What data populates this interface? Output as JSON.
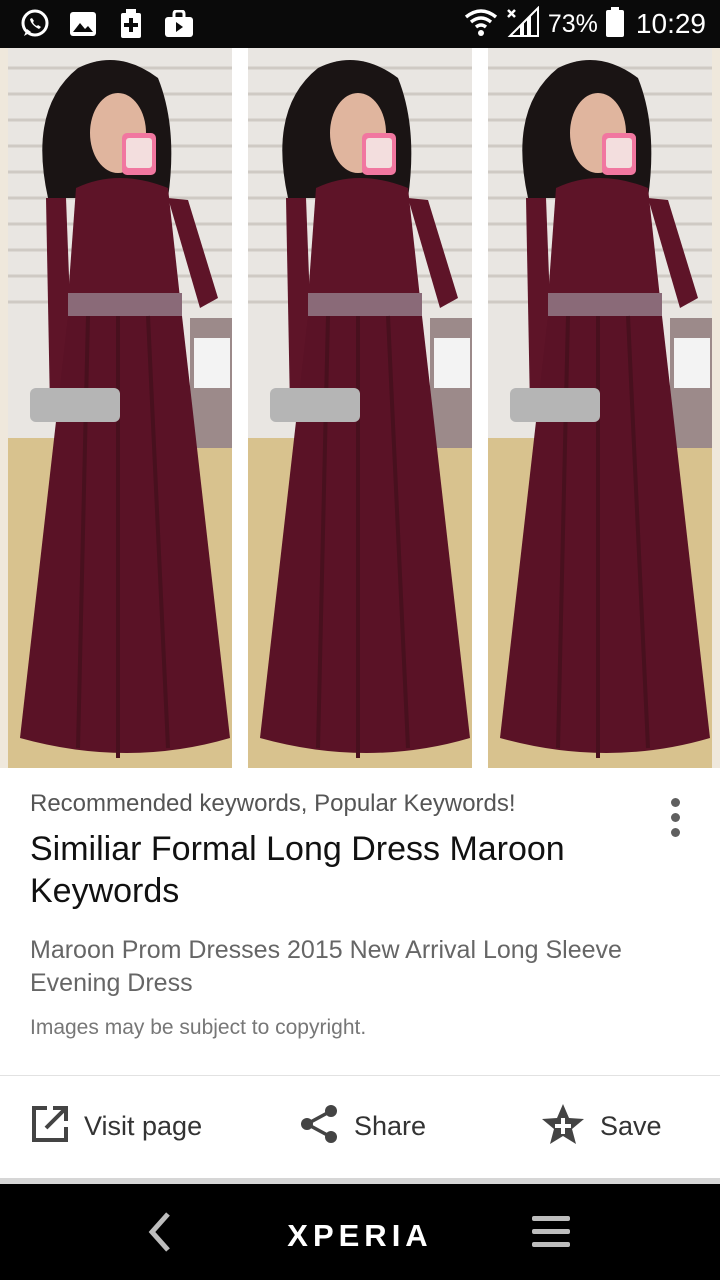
{
  "status_bar": {
    "icons_left": [
      "whatsapp-icon",
      "gallery-icon",
      "health-plus-icon",
      "shopping-bag-icon"
    ],
    "wifi": "wifi-icon",
    "signal": "signal-no-data-icon",
    "battery_percent": "73%",
    "time": "10:29"
  },
  "image": {
    "subject": "maroon-long-sleeve-evening-dress",
    "colors": {
      "dress": "#5a1226",
      "background_floor": "#d8c28e",
      "blinds": "#e9e6e2"
    }
  },
  "result": {
    "source": "Recommended keywords, Popular Keywords!",
    "title": "Similiar Formal Long Dress Maroon Keywords",
    "description": "Maroon Prom Dresses 2015 New Arrival Long Sleeve Evening Dress",
    "copyright": "Images may be subject to copyright."
  },
  "actions": {
    "visit_label": "Visit page",
    "share_label": "Share",
    "save_label": "Save"
  },
  "nav": {
    "brand": "XPERIA"
  }
}
